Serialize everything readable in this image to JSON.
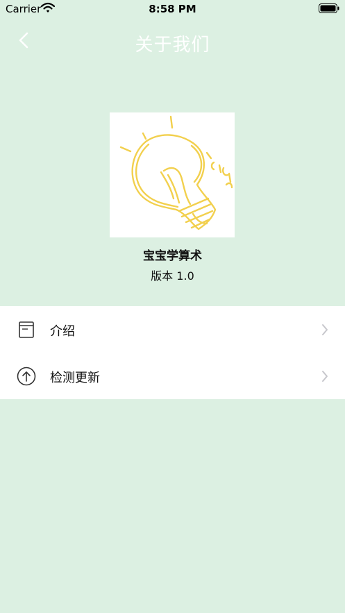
{
  "status_bar": {
    "carrier": "Carrier",
    "time": "8:58 PM",
    "wifi_icon": "wifi-icon",
    "battery_icon": "battery-icon"
  },
  "nav": {
    "title": "关于我们",
    "back_icon": "chevron-left-icon"
  },
  "app": {
    "name": "宝宝学算术",
    "version": "版本 1.0",
    "logo_icon": "lightbulb-icon"
  },
  "menu": {
    "items": [
      {
        "label": "介绍",
        "icon": "book-icon"
      },
      {
        "label": "检测更新",
        "icon": "arrow-up-circle-icon"
      }
    ],
    "chevron_icon": "chevron-right-icon"
  },
  "colors": {
    "background": "#dcf0e2",
    "nav_title": "#ffffff",
    "logo_yellow": "#f2d04e",
    "chevron": "#c7c7cc"
  }
}
